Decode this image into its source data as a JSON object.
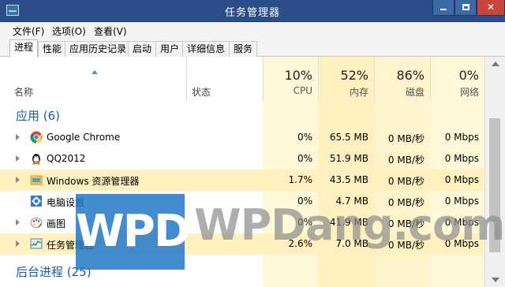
{
  "window": {
    "title": "任务管理器",
    "min_label": "",
    "close_label": "✕"
  },
  "menu": [
    "文件(F)",
    "选项(O)",
    "查看(V)"
  ],
  "tabs": [
    "进程",
    "性能",
    "应用历史记录",
    "启动",
    "用户",
    "详细信息",
    "服务"
  ],
  "active_tab": "进程",
  "header": {
    "name": "名称",
    "status": "状态",
    "cpu": {
      "pct": "10%",
      "label": "CPU"
    },
    "memory": {
      "pct": "52%",
      "label": "内存"
    },
    "disk": {
      "pct": "86%",
      "label": "磁盘"
    },
    "network": {
      "pct": "0%",
      "label": "网络"
    }
  },
  "groups": {
    "apps": "应用 (6)",
    "background": "后台进程 (25)"
  },
  "processes": [
    {
      "name": "Google Chrome",
      "icon": "chrome-icon",
      "expandable": true,
      "cpu": "0%",
      "memory": "65.5 MB",
      "disk": "0 MB/秒",
      "network": "0 Mbps"
    },
    {
      "name": "QQ2012",
      "icon": "qq-icon",
      "expandable": true,
      "cpu": "0%",
      "memory": "51.9 MB",
      "disk": "0 MB/秒",
      "network": "0 Mbps"
    },
    {
      "name": "Windows 资源管理器",
      "icon": "explorer-icon",
      "expandable": true,
      "cpu": "1.7%",
      "memory": "43.5 MB",
      "disk": "0 MB/秒",
      "network": "0 Mbps"
    },
    {
      "name": "电脑设置",
      "icon": "settings-icon",
      "expandable": false,
      "cpu": "0%",
      "memory": "4.7 MB",
      "disk": "0 MB/秒",
      "network": "0 Mbps"
    },
    {
      "name": "画图",
      "icon": "paint-icon",
      "expandable": true,
      "cpu": "0%",
      "memory": "41.9 MB",
      "disk": "0 MB/秒",
      "network": "0 Mbps"
    },
    {
      "name": "任务管理器",
      "icon": "task-manager-icon",
      "expandable": true,
      "cpu": "2.6%",
      "memory": "7.0 MB",
      "disk": "0 MB/秒",
      "network": "0 Mbps"
    }
  ],
  "watermark": {
    "logo": "WPD",
    "text": "WPDang.com"
  },
  "colors": {
    "titlebar": "#2b4e8a",
    "group_text": "#1e5aa8",
    "heat_light": "#fff4c4",
    "heat_mid": "#ffe9a0",
    "close_button": "#c7453a"
  }
}
